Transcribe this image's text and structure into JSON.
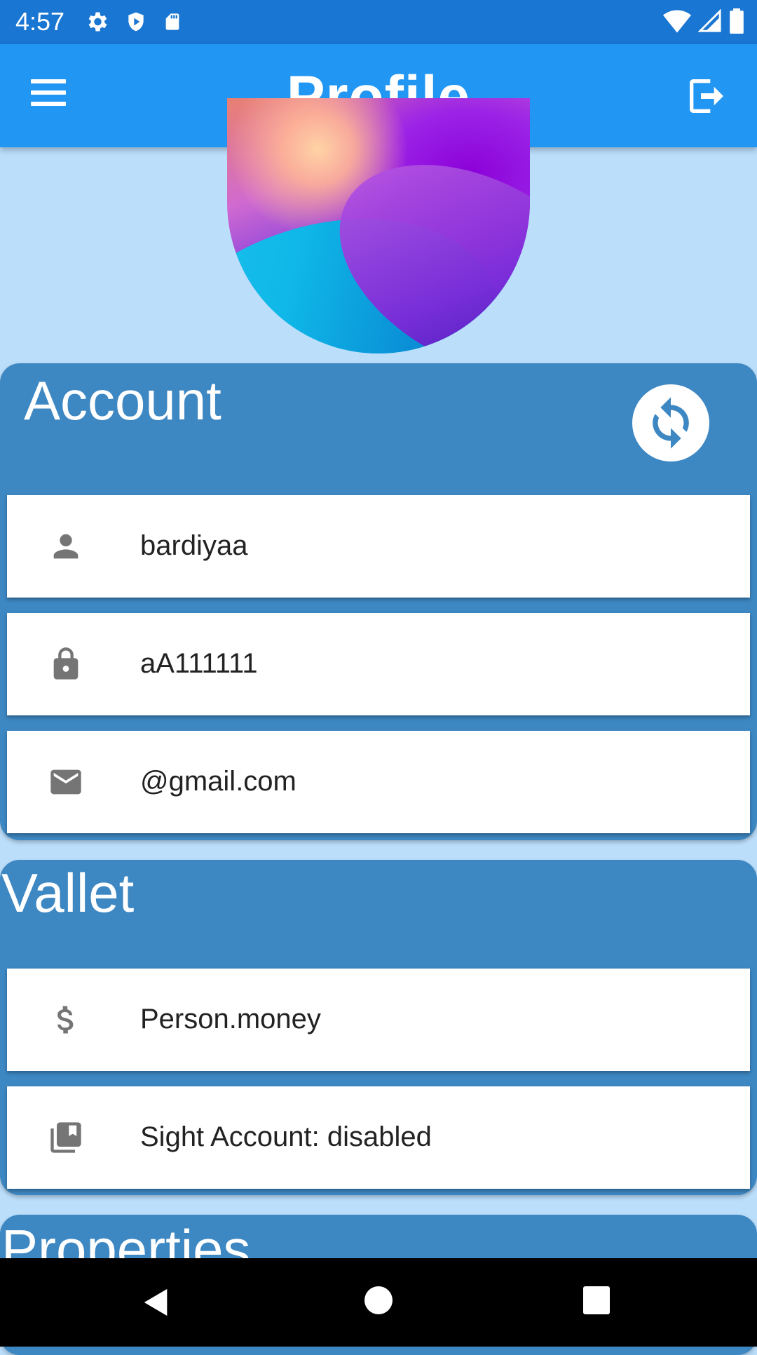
{
  "status_bar": {
    "time": "4:57",
    "left_icons": [
      "gear-icon",
      "shield-icon",
      "sd-card-icon"
    ],
    "right_icons": [
      "wifi-icon",
      "cell-signal-icon",
      "battery-icon"
    ]
  },
  "app_bar": {
    "title": "Profile",
    "menu_icon": "hamburger-menu-icon",
    "logout_icon": "logout-icon"
  },
  "account": {
    "title": "Account",
    "refresh_icon": "sync-icon",
    "rows": [
      {
        "icon": "person-icon",
        "value": "bardiyaa"
      },
      {
        "icon": "lock-icon",
        "value": "aA111111"
      },
      {
        "icon": "mail-icon",
        "value": "@gmail.com"
      }
    ]
  },
  "wallet": {
    "title": "Vallet",
    "rows": [
      {
        "icon": "dollar-icon",
        "value": "Person.money"
      },
      {
        "icon": "library-books-icon",
        "value": "Sight Account: disabled"
      }
    ]
  },
  "properties": {
    "title": "Properties"
  },
  "colors": {
    "status_bar": "#1976d2",
    "app_bar": "#2196f3",
    "background": "#bbdefb",
    "section": "#3d87c2",
    "row": "#ffffff"
  }
}
